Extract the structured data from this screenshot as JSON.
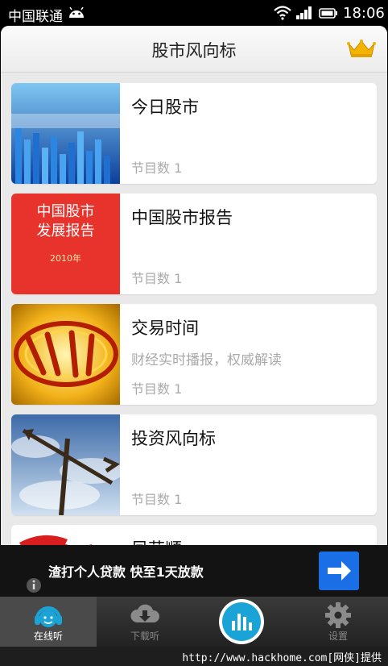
{
  "status_bar": {
    "carrier": "中国联通",
    "time": "18:06"
  },
  "header": {
    "title": "股市风向标",
    "crown_icon": "crown-icon"
  },
  "programs": [
    {
      "title": "今日股市",
      "desc": "",
      "count": "节目数 1"
    },
    {
      "title": "中国股市报告",
      "desc": "",
      "count": "节目数 1",
      "cover_lines": [
        "中国股市",
        "发展报告",
        "2010年"
      ]
    },
    {
      "title": "交易时间",
      "desc": "财经实时播报，权威解读",
      "count": "节目数 1"
    },
    {
      "title": "投资风向标",
      "desc": "",
      "count": "节目数 1"
    },
    {
      "title": "凤莊順",
      "desc": "",
      "count": ""
    }
  ],
  "ad": {
    "text": "渣打个人贷款 快至1天放款"
  },
  "tabs": [
    {
      "label": "在线听",
      "active": true
    },
    {
      "label": "下载听",
      "active": false
    },
    {
      "label": "设置",
      "active": false
    }
  ],
  "footer": {
    "watermark": "http://www.hackhome.com[网侠]提供"
  },
  "colors": {
    "accent": "#1a6ee6",
    "player": "#1aa3d6"
  }
}
